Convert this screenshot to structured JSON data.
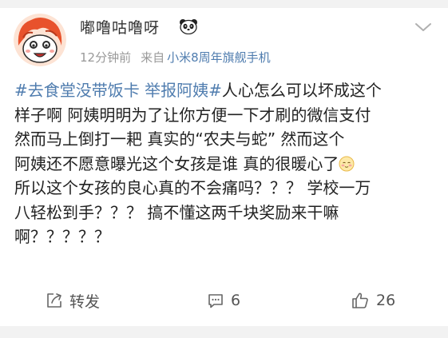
{
  "post": {
    "username": "嘟噜咕噜呀",
    "badge_icon": "panda-icon",
    "time": "12分钟前",
    "source_prefix": "来自",
    "device": "小米8周年旗舰手机",
    "content": {
      "line1_topic": "#去食堂没带饭卡 举报阿姨#",
      "line1_text": "人心怎么可以坏成这个",
      "line2": "样子啊 阿姨明明为了让你方便一下才刷的微信支付",
      "line3": "然而马上倒打一耙 真实的“农夫与蛇” 然而这个",
      "line4": "阿姨还不愿意曝光这个女孩是谁 真的很暖心了",
      "line4_emoji": "blush-emoji",
      "line5": "所以这个女孩的良心真的不会痛吗？？？ 学校一万",
      "line6": "八轻松到手？？？ 搞不懂这两千块奖励来干嘛",
      "line7": "啊？？？？？"
    },
    "actions": {
      "repost_label": "转发",
      "comment_count": "6",
      "like_count": "26"
    },
    "colors": {
      "topic": "#507daf",
      "text": "#222222",
      "meta": "#999999",
      "divider": "#f2f2f2"
    }
  }
}
